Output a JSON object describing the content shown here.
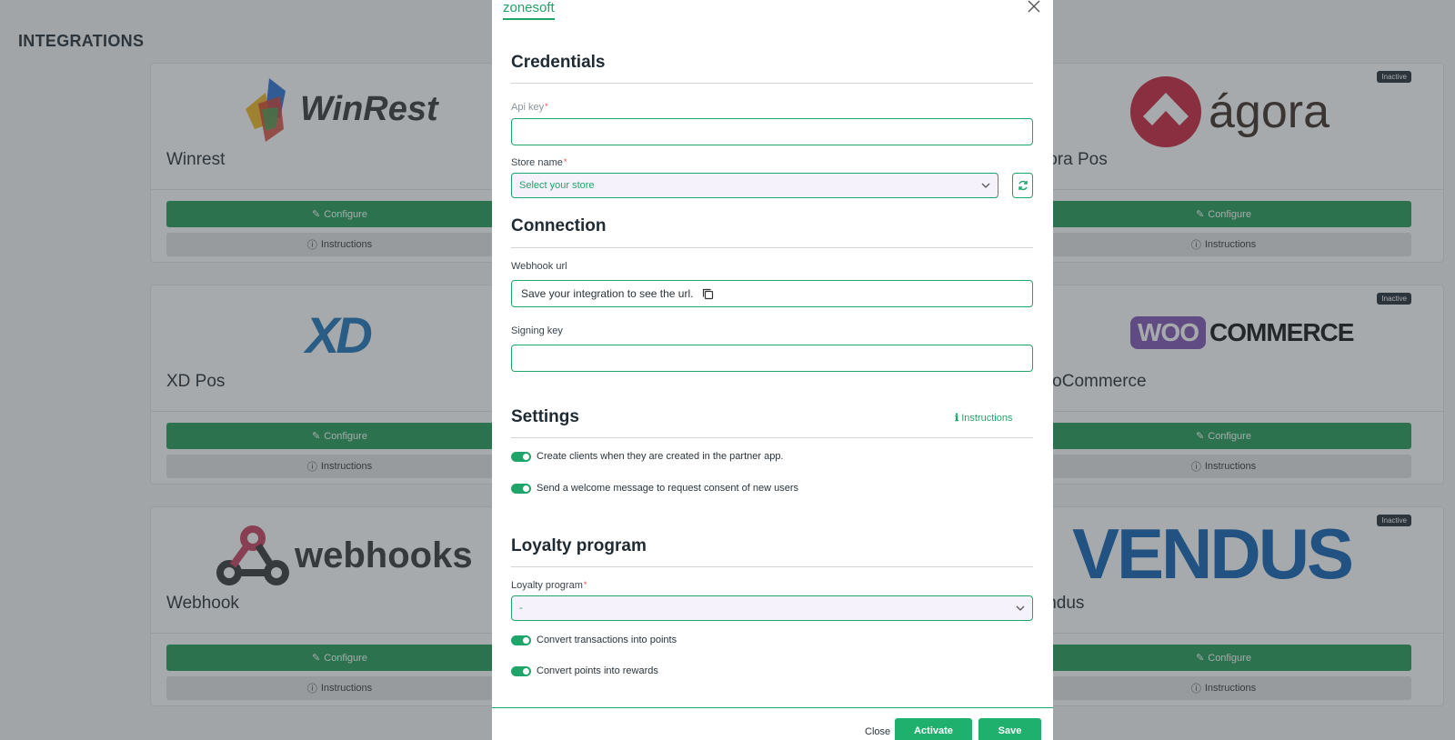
{
  "page": {
    "title": "INTEGRATIONS"
  },
  "cards": {
    "winrest": {
      "name": "Winrest",
      "logo_text": "WinRest"
    },
    "xdpos": {
      "name": "XD Pos",
      "logo_text": "XD"
    },
    "webhook": {
      "name": "Webhook",
      "logo_text": "webhooks"
    },
    "agora": {
      "name": "Agora Pos",
      "logo_text": "ágora",
      "badge": "Inactive"
    },
    "woocommerce": {
      "name": "WooCommerce",
      "logo_woo": "WOO",
      "logo_commerce": "COMMERCE",
      "badge": "Inactive"
    },
    "vendus": {
      "name": "Vendus",
      "logo_text": "VENDUS",
      "badge": "Inactive"
    }
  },
  "card_buttons": {
    "configure": "Configure",
    "instructions": "Instructions"
  },
  "modal": {
    "tab": "zonesoft",
    "credentials": {
      "title": "Credentials",
      "api_key_label": "Api key",
      "api_key_value": "",
      "store_name_label": "Store name",
      "store_placeholder": "Select your store"
    },
    "connection": {
      "title": "Connection",
      "webhook_label": "Webhook url",
      "webhook_value": "Save your integration to see the url.",
      "signing_key_label": "Signing key",
      "signing_key_value": ""
    },
    "settings": {
      "title": "Settings",
      "instructions_link": "Instructions",
      "toggle_create_clients": "Create clients when they are created in the partner app.",
      "toggle_welcome": "Send a welcome message to request consent of new users"
    },
    "loyalty": {
      "title": "Loyalty program",
      "program_label": "Loyalty program",
      "program_value": "-",
      "toggle_transactions": "Convert transactions into points",
      "toggle_rewards": "Convert points into rewards"
    },
    "footer": {
      "close": "Close",
      "activate": "Activate",
      "save": "Save"
    }
  },
  "colors": {
    "accent": "#1fa56a",
    "configure_green": "#1f9a55"
  }
}
